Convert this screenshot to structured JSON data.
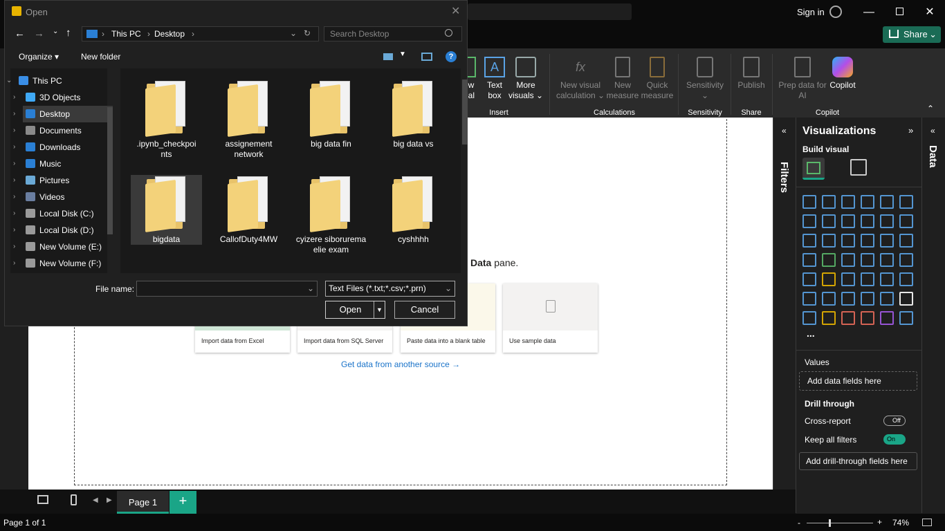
{
  "titlebar": {
    "signin": "Sign in",
    "share": "Share"
  },
  "ribbon": {
    "buttons": [
      {
        "label": "ew\nual"
      },
      {
        "label": "Text\nbox"
      },
      {
        "label": "More\nvisuals ⌄"
      },
      {
        "label": "New visual\ncalculation ⌄"
      },
      {
        "label": "New\nmeasure"
      },
      {
        "label": "Quick\nmeasure"
      },
      {
        "label": "Sensitivity\n⌄"
      },
      {
        "label": "Publish"
      },
      {
        "label": "Prep data for\nAI"
      },
      {
        "label": "Copilot"
      }
    ],
    "groups": [
      "Insert",
      "Calculations",
      "Sensitivity",
      "Share",
      "Copilot"
    ]
  },
  "canvas": {
    "datapane_text_bold": "Data",
    "datapane_text_rest": " pane.",
    "cards": [
      "Import data from Excel",
      "Import data from SQL Server",
      "Paste data into a blank table",
      "Use sample data"
    ],
    "get_data_link": "Get data from another source →"
  },
  "filters": {
    "label": "Filters"
  },
  "viz": {
    "title": "Visualizations",
    "build_visual": "Build visual",
    "more": "...",
    "values_label": "Values",
    "values_placeholder": "Add data fields here",
    "drill_label": "Drill through",
    "cross_report": "Cross-report",
    "cross_report_state": "Off",
    "keep_filters": "Keep all filters",
    "keep_filters_state": "On",
    "drill_placeholder": "Add drill-through fields here"
  },
  "data_pane": {
    "label": "Data"
  },
  "pages": {
    "tab": "Page 1",
    "add": "+"
  },
  "status": {
    "page_count": "Page 1 of 1",
    "zoom": "74%"
  },
  "dialog": {
    "title": "Open",
    "breadcrumb": [
      "This PC",
      "Desktop"
    ],
    "search_placeholder": "Search Desktop",
    "organize": "Organize ▾",
    "new_folder": "New folder",
    "tree": [
      {
        "label": "This PC",
        "color": "#3a8ee6"
      },
      {
        "label": "3D Objects",
        "color": "#3fa9f5"
      },
      {
        "label": "Desktop",
        "color": "#2a7fd4"
      },
      {
        "label": "Documents",
        "color": "#8a8a8a"
      },
      {
        "label": "Downloads",
        "color": "#2a7fd4"
      },
      {
        "label": "Music",
        "color": "#2a7fd4"
      },
      {
        "label": "Pictures",
        "color": "#6aa9d6"
      },
      {
        "label": "Videos",
        "color": "#6a7ea0"
      },
      {
        "label": "Local Disk (C:)",
        "color": "#9a9a9a"
      },
      {
        "label": "Local Disk (D:)",
        "color": "#9a9a9a"
      },
      {
        "label": "New Volume (E:)",
        "color": "#9a9a9a"
      },
      {
        "label": "New Volume (F:)",
        "color": "#9a9a9a"
      }
    ],
    "folders": [
      ".ipynb_checkpoi nts",
      "assignement network",
      "big data fin",
      "big data vs",
      "bigdata",
      "CallofDuty4MW",
      "cyizere siborurema elie exam",
      "cyshhhh"
    ],
    "file_name_label": "File name:",
    "file_name_value": "",
    "file_type": "Text Files (*.txt;*.csv;*.prn)",
    "open_button": "Open",
    "cancel_button": "Cancel"
  }
}
